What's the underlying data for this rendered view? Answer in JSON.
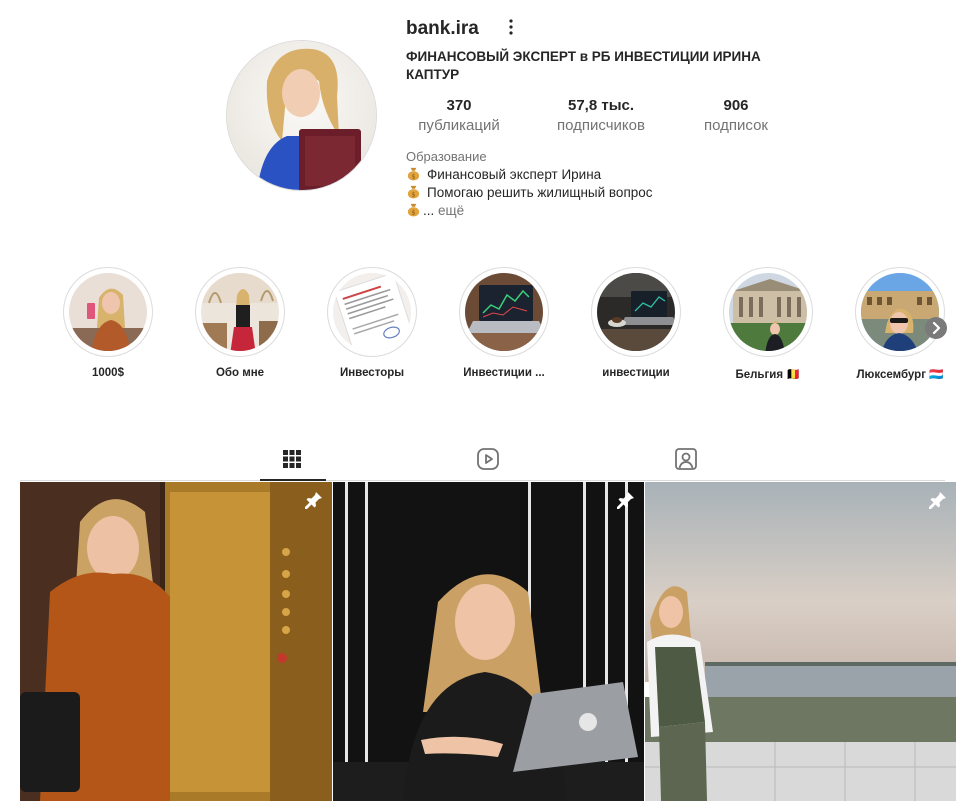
{
  "profile": {
    "username": "bank.ira",
    "full_name": "ФИНАНСОВЫЙ ЭКСПЕРТ в РБ ИНВЕСТИЦИИ ИРИНА КАПТУР",
    "stats": [
      {
        "value": "370",
        "label": "публикаций"
      },
      {
        "value": "57,8 тыс.",
        "label": "подписчиков"
      },
      {
        "value": "906",
        "label": "подписок"
      }
    ],
    "category": "Образование",
    "bio_lines": [
      "Финансовый эксперт Ирина",
      "Помогаю решить жилищный вопрос",
      "..."
    ],
    "more_label": "ещё"
  },
  "highlights": [
    {
      "name": "1000$"
    },
    {
      "name": "Обо мне"
    },
    {
      "name": "Инвесторы"
    },
    {
      "name": "Инвестиции ..."
    },
    {
      "name": "инвестиции"
    },
    {
      "name": "Бельгия 🇧🇪"
    },
    {
      "name": "Люксембург 🇱🇺"
    }
  ],
  "tabs": [
    {
      "icon": "grid-icon",
      "active": true
    },
    {
      "icon": "reels-icon",
      "active": false
    },
    {
      "icon": "tagged-icon",
      "active": false
    }
  ],
  "posts": [
    {
      "pinned": true,
      "icon": "pin-icon"
    },
    {
      "pinned": true,
      "icon": "pin-icon"
    },
    {
      "pinned": true,
      "icon": "pin-icon"
    }
  ],
  "colors": {
    "text": "#262626",
    "secondary": "#737373",
    "border": "#dbdbdb"
  }
}
